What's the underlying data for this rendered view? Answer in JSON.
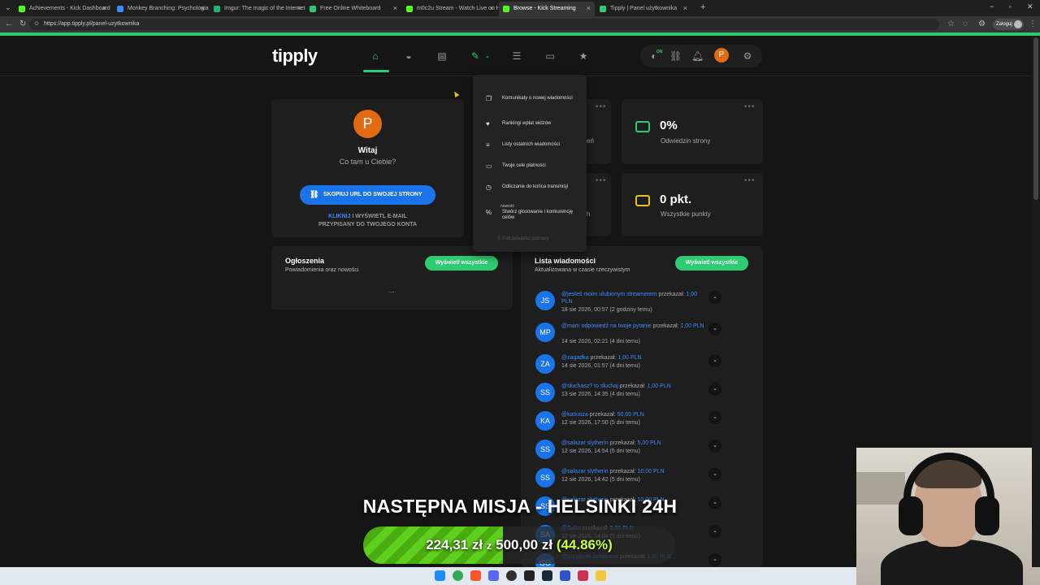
{
  "browser": {
    "tabs": [
      {
        "label": "Achievements - Kick Dashboard",
        "color": "#53fc18"
      },
      {
        "label": "Monkey Branching: Psychologia Z",
        "color": "#3b8bff"
      },
      {
        "label": "Imgur: The magic of the Internet",
        "color": "#1bb76e"
      },
      {
        "label": "Free Online Whiteboard",
        "color": "#2ecc71"
      },
      {
        "label": "m0c2u Stream - Watch Live on Ki",
        "color": "#53fc18"
      },
      {
        "label": "Browse - Kick Streaming",
        "color": "#53fc18"
      },
      {
        "label": "Tipply | Panel użytkownika",
        "color": "#2ecc71"
      }
    ],
    "url": "https://app.tipply.pl/panel-uzytkownika",
    "profile_label": "Zaloguj"
  },
  "app": {
    "logo": "tipply",
    "nav_icons": [
      "home-icon",
      "inbox-icon",
      "wallet-icon",
      "edit-icon",
      "layers-icon",
      "window-icon",
      "star-icon"
    ],
    "right_icons": [
      "toggle-icon",
      "link-icon",
      "bell-icon",
      "gear-icon"
    ],
    "toggle_badge": "ON",
    "avatar_letter": "P"
  },
  "welcome": {
    "avatar_letter": "P",
    "title": "Witaj",
    "subtitle": "Co tam u Ciebie?",
    "copy_button": "SKOPIUJ URL DO SWOJEJ STRONY",
    "email_link": "KLIKNIJ",
    "email_note_1": " I WYŚWIETL E-MAIL",
    "email_note_2": "PRZYPISANY DO TWOJEGO KONTA"
  },
  "stats": {
    "visits_value": "0%",
    "visits_label": "Odwiedzin strony",
    "points_value": "0 pkt.",
    "points_label": "Wszystkie punkty",
    "hidden_label_1": "eń",
    "hidden_label_2": "h"
  },
  "announcements": {
    "title": "Ogłoszenia",
    "subtitle": "Powiadomienia oraz nowości",
    "button": "Wyświetl wszystkie",
    "placeholder": "..."
  },
  "messages": {
    "title": "Lista wiadomości",
    "subtitle": "Aktualizowana w czasie rzeczywistym",
    "button": "Wyświetl wszystkie",
    "verb": "przekazał:",
    "items": [
      {
        "initials": "JS",
        "user": "@jesteś moim ulubionym streamerem",
        "amount": "1,00 PLN",
        "time": "18 sie 2026, 00:57 (2 godziny temu)",
        "wrap": true
      },
      {
        "initials": "MP",
        "user": "@mam odpowiedź na twoje pytanie",
        "amount": "1,00 PLN",
        "time": "14 sie 2026, 02:21 (4 dni temu)",
        "wrap": true
      },
      {
        "initials": "ZA",
        "user": "@zagadka",
        "amount": "1,00 PLN",
        "time": "14 sie 2026, 01:57 (4 dni temu)",
        "wrap": false
      },
      {
        "initials": "SS",
        "user": "@słuchasz? to słuchaj",
        "amount": "1,00 PLN",
        "time": "13 sie 2026, 14:35 (4 dni temu)",
        "wrap": false
      },
      {
        "initials": "KA",
        "user": "@katiusza",
        "amount": "50,00 PLN",
        "time": "12 sie 2026, 17:50 (5 dni temu)",
        "wrap": false
      },
      {
        "initials": "SS",
        "user": "@salazar slytherin",
        "amount": "5,00 PLN",
        "time": "12 sie 2026, 14:54 (5 dni temu)",
        "wrap": false
      },
      {
        "initials": "SS",
        "user": "@salazar slytherin",
        "amount": "10,00 PLN",
        "time": "12 sie 2026, 14:42 (5 dni temu)",
        "wrap": false
      },
      {
        "initials": "SS",
        "user": "@salazar slytherin",
        "amount": "10,00 PLN",
        "time": "",
        "wrap": false
      },
      {
        "initials": "SA",
        "user": "@Satro",
        "amount": "3,00 PLN",
        "time": "12 sie 2026, 14:04 (5 dni temu)",
        "wrap": false
      },
      {
        "initials": "GO",
        "user": "@przyjaciel streamera",
        "amount": "1,00 PLN",
        "time": "",
        "wrap": false
      }
    ]
  },
  "dropdown": {
    "items": [
      {
        "icon": "copy-icon",
        "glyph": "❐",
        "label": "Komunikaty o nowej wiadomości"
      },
      {
        "icon": "heart-icon",
        "glyph": "♥",
        "label": "Rankingi wpłat widzów"
      },
      {
        "icon": "list-icon",
        "glyph": "≡",
        "label": "Listy ostatnich wiadomości"
      },
      {
        "icon": "card-icon",
        "glyph": "▭",
        "label": "Twoje cele płatności"
      },
      {
        "icon": "clock-icon",
        "glyph": "◷",
        "label": "Odliczanie do końca transmisji"
      },
      {
        "icon": "percent-icon",
        "glyph": "%",
        "label": "Stwórz głosowanie i konkurencję celów"
      }
    ],
    "new_badge": "nowość",
    "footer": "Potrzebujesz pomocy"
  },
  "overlay": {
    "mission": "NASTĘPNA MISJA - HELSINKI 24H",
    "current": "224,31 zł",
    "joiner": "z",
    "goal": "500,00 zł",
    "percent_text": "(44.86%)",
    "progress_fraction": 0.4486
  },
  "taskbar": {
    "icons": [
      "windows-icon",
      "chrome-icon",
      "brave-icon",
      "discord-icon",
      "obs-icon",
      "app-icon",
      "steam-icon",
      "app2-icon",
      "app3-icon",
      "files-icon"
    ]
  }
}
